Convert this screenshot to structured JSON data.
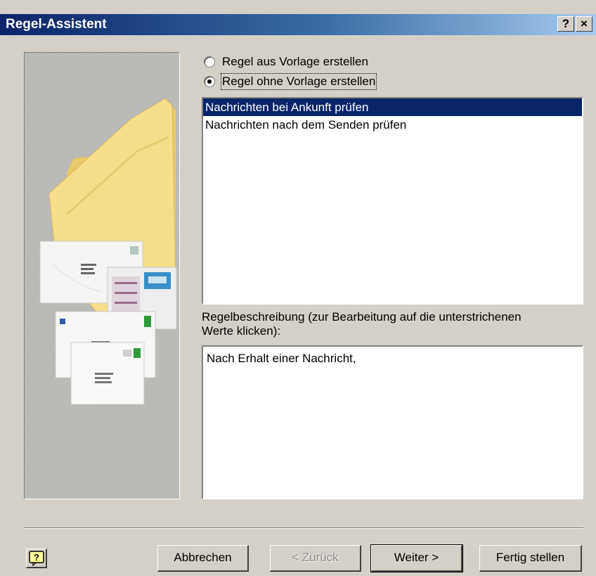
{
  "window": {
    "title": "Regel-Assistent",
    "help_glyph": "?",
    "close_glyph": "×"
  },
  "options": [
    {
      "label": "Regel aus Vorlage erstellen",
      "checked": false
    },
    {
      "label": "Regel ohne Vorlage erstellen",
      "checked": true
    }
  ],
  "rule_list": {
    "items": [
      {
        "label": "Nachrichten bei Ankunft prüfen",
        "selected": true
      },
      {
        "label": "Nachrichten nach dem Senden prüfen",
        "selected": false
      }
    ]
  },
  "description": {
    "label": "Regelbeschreibung (zur Bearbeitung auf die unterstrichenen Werte klicken):",
    "text": "Nach Erhalt einer Nachricht,"
  },
  "buttons": {
    "cancel": "Abbrechen",
    "back": "< Zurück",
    "next": "Weiter >",
    "finish": "Fertig stellen"
  },
  "colors": {
    "titlebar_start": "#0a246a",
    "titlebar_end": "#a6caf0",
    "selection": "#0a246a",
    "dialog_bg": "#d4d0c8"
  },
  "icons": {
    "help_button": "help-question-icon",
    "illustration": "folder-envelopes-illustration"
  }
}
